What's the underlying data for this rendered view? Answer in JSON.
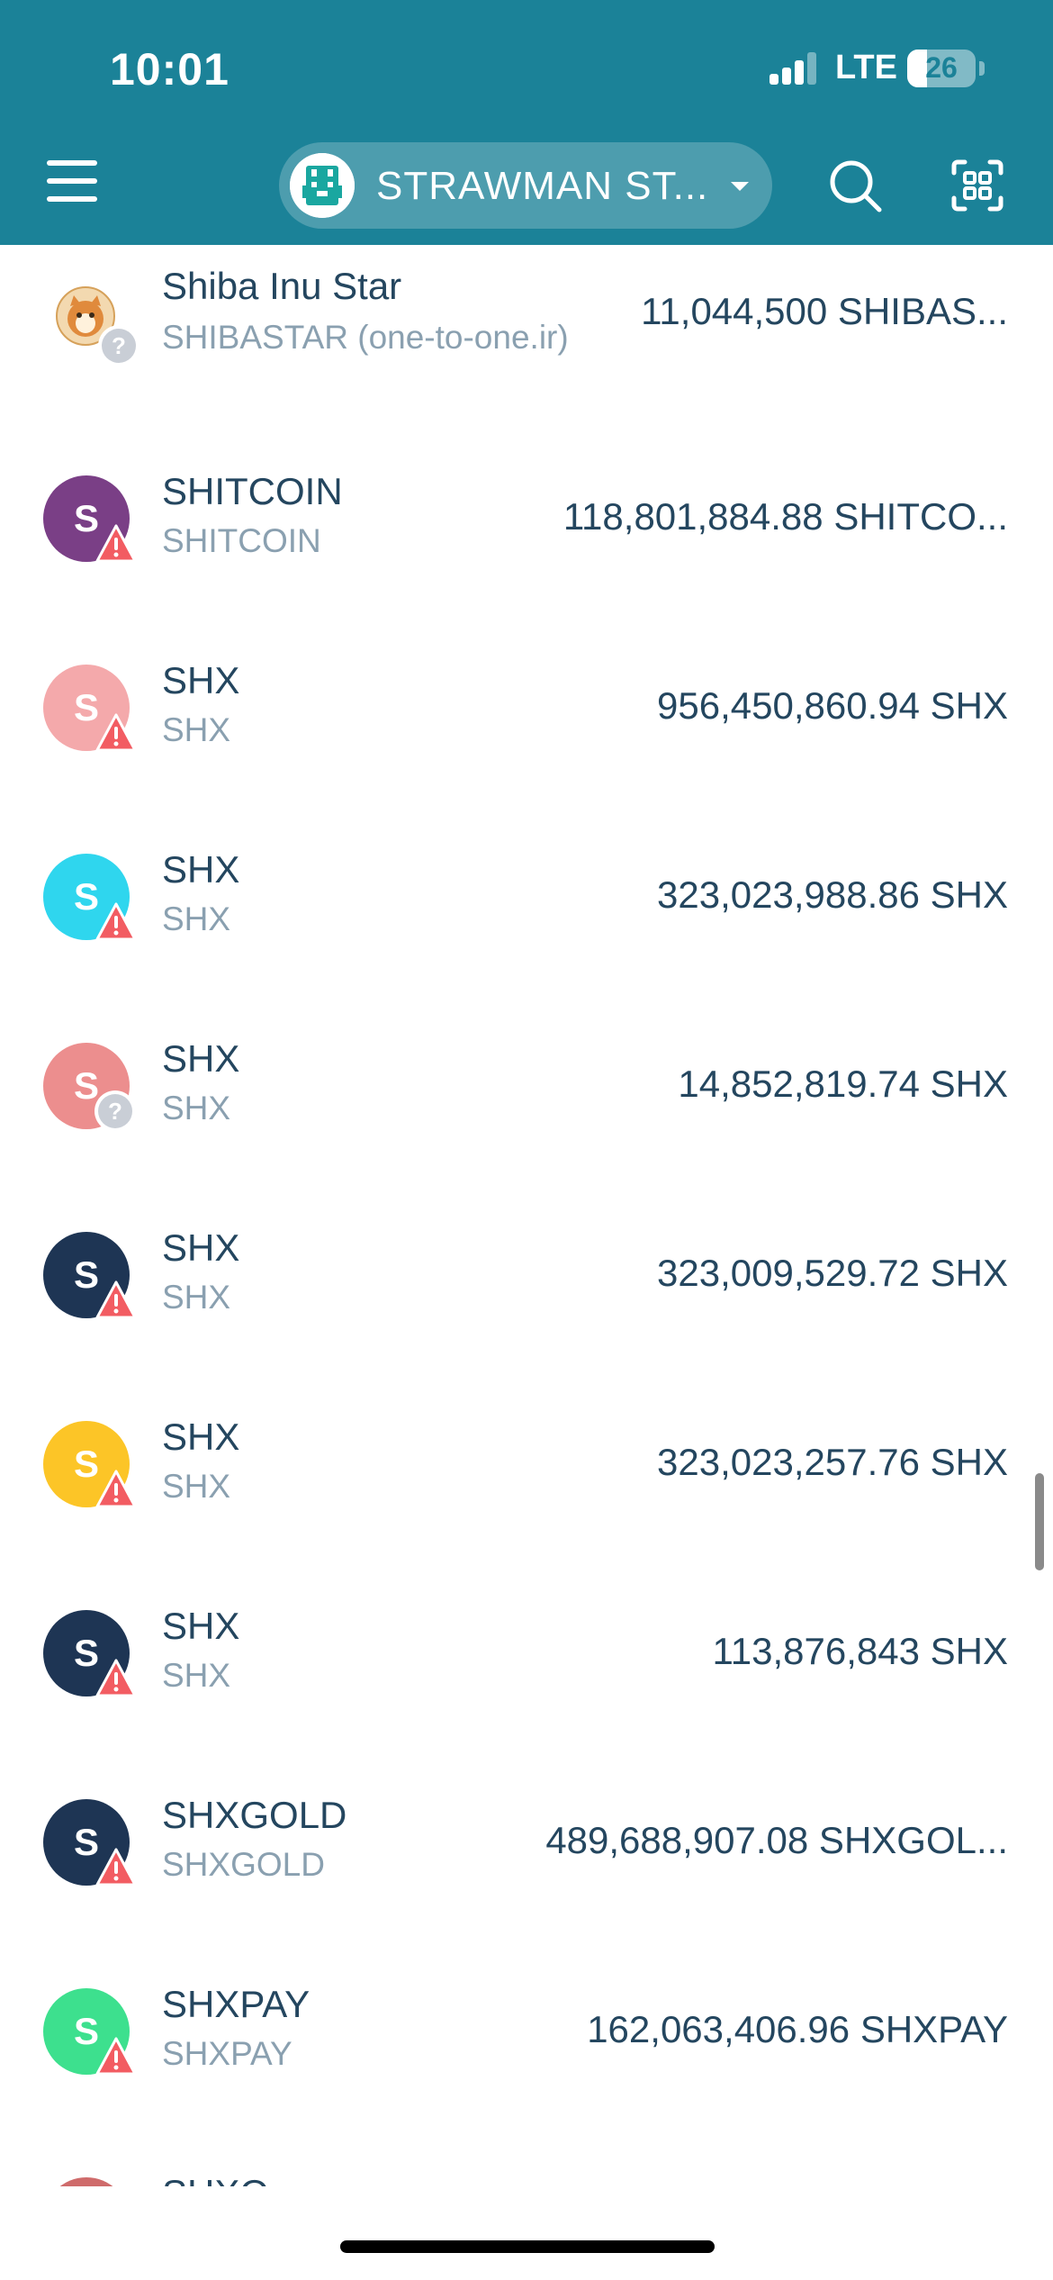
{
  "status_bar": {
    "time": "10:01",
    "network": "LTE",
    "battery": "26"
  },
  "header": {
    "menu_icon": "hamburger-menu-icon",
    "account_name": "STRAWMAN ST...",
    "account_icon": "pixel-avatar-icon",
    "search_icon": "search-icon",
    "scan_icon": "qr-scan-icon"
  },
  "colors": {
    "header": "#1b8298",
    "warning": "#f25c62",
    "unknown_badge": "#c9ced6"
  },
  "tokens": [
    {
      "name": "Shiba Inu Star",
      "symbol": "SHIBASTAR (one-to-one.ir)",
      "balance": "11,044,500 SHIBAS...",
      "avatar_letter": "",
      "avatar_color": "#f5c27a",
      "badge": "unknown"
    },
    {
      "name": "SHITCOIN",
      "symbol": "SHITCOIN",
      "balance": "118,801,884.88 SHITCO...",
      "avatar_letter": "S",
      "avatar_color": "#7a3f86",
      "badge": "warning"
    },
    {
      "name": "SHX",
      "symbol": "SHX",
      "balance": "956,450,860.94 SHX",
      "avatar_letter": "S",
      "avatar_color": "#f4a9ab",
      "badge": "warning"
    },
    {
      "name": "SHX",
      "symbol": "SHX",
      "balance": "323,023,988.86 SHX",
      "avatar_letter": "S",
      "avatar_color": "#2fd6ee",
      "badge": "warning"
    },
    {
      "name": "SHX",
      "symbol": "SHX",
      "balance": "14,852,819.74 SHX",
      "avatar_letter": "S",
      "avatar_color": "#ec8e8e",
      "badge": "unknown"
    },
    {
      "name": "SHX",
      "symbol": "SHX",
      "balance": "323,009,529.72 SHX",
      "avatar_letter": "S",
      "avatar_color": "#1e3554",
      "badge": "warning"
    },
    {
      "name": "SHX",
      "symbol": "SHX",
      "balance": "323,023,257.76 SHX",
      "avatar_letter": "S",
      "avatar_color": "#fcc527",
      "badge": "warning"
    },
    {
      "name": "SHX",
      "symbol": "SHX",
      "balance": "113,876,843 SHX",
      "avatar_letter": "S",
      "avatar_color": "#1e3554",
      "badge": "warning"
    },
    {
      "name": "SHXGOLD",
      "symbol": "SHXGOLD",
      "balance": "489,688,907.08 SHXGOL...",
      "avatar_letter": "S",
      "avatar_color": "#1e3554",
      "badge": "warning"
    },
    {
      "name": "SHXPAY",
      "symbol": "SHXPAY",
      "balance": "162,063,406.96 SHXPAY",
      "avatar_letter": "S",
      "avatar_color": "#3de08e",
      "badge": "warning"
    },
    {
      "name": "SHXO",
      "symbol": "",
      "balance": "",
      "avatar_letter": "",
      "avatar_color": "#cf6b6b",
      "badge": "none"
    }
  ]
}
